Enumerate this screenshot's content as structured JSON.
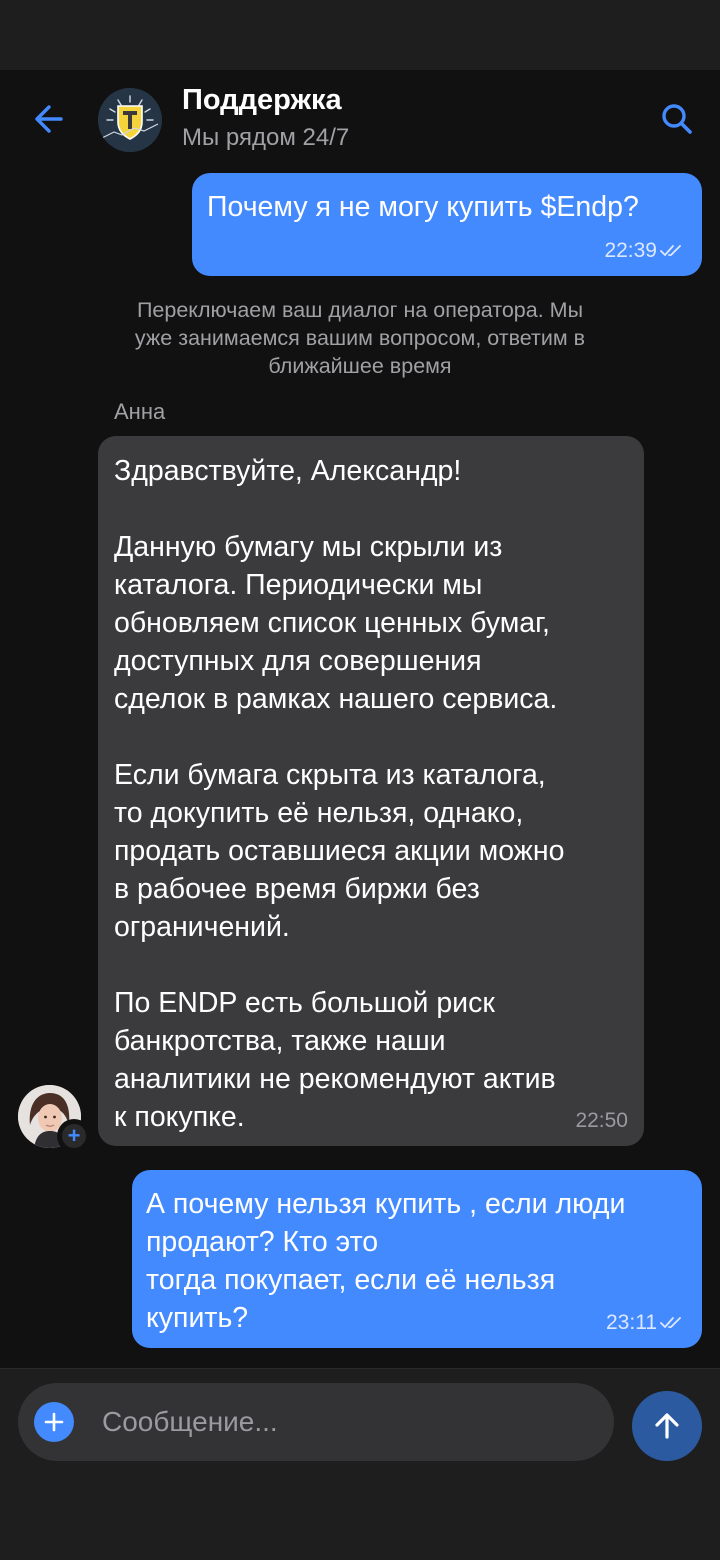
{
  "colors": {
    "accent": "#448aff",
    "outgoing_bubble": "#448aff",
    "incoming_bubble": "#3b3b3d",
    "chat_background": "#111111",
    "status_bar_background": "#1e1e1e",
    "muted_text": "#a0a0a5",
    "send_button": "#2c5aa0"
  },
  "header": {
    "back_icon": "arrow-left-icon",
    "avatar_icon": "bank-shield-logo",
    "title": "Поддержка",
    "subtitle": "Мы рядом 24/7",
    "search_icon": "search-icon"
  },
  "messages": {
    "outgoing_1": {
      "lines": [
        "Почему я не могу купить $Endp?"
      ],
      "time": "22:39",
      "status_icon": "double-check-icon"
    },
    "system_note": {
      "lines": [
        "Переключаем ваш диалог на оператора. Мы",
        "уже занимаемся вашим вопросом, ответим в",
        "ближайшее время"
      ]
    },
    "incoming_1": {
      "sender": "Анна",
      "avatar_icon": "agent-photo",
      "badge_icon": "plus-icon",
      "badge_text": "+",
      "lines": [
        "Здравствуйте, Александр!",
        "",
        "Данную бумагу мы скрыли из",
        "каталога. Периодически мы",
        "обновляем список ценных бумаг,",
        "доступных для совершения",
        "сделок в рамках нашего сервиса.",
        "",
        "Если бумага скрыта из каталога,",
        "то докупить её нельзя, однако,",
        "продать оставшиеся акции можно",
        "в рабочее время биржи без",
        "ограничений.",
        "",
        "По ENDP есть большой риск",
        "банкротства, также наши",
        "аналитики не рекомендуют актив",
        "к покупке."
      ],
      "time": "22:50"
    },
    "outgoing_2": {
      "lines": [
        "А почему нельзя купить , если люди",
        "продают? Кто это",
        "тогда покупает, если её нельзя",
        "купить?"
      ],
      "time": "23:11",
      "status_icon": "double-check-icon"
    }
  },
  "composer": {
    "attach_icon": "plus-icon",
    "placeholder": "Сообщение...",
    "value": "",
    "send_icon": "arrow-up-icon"
  }
}
